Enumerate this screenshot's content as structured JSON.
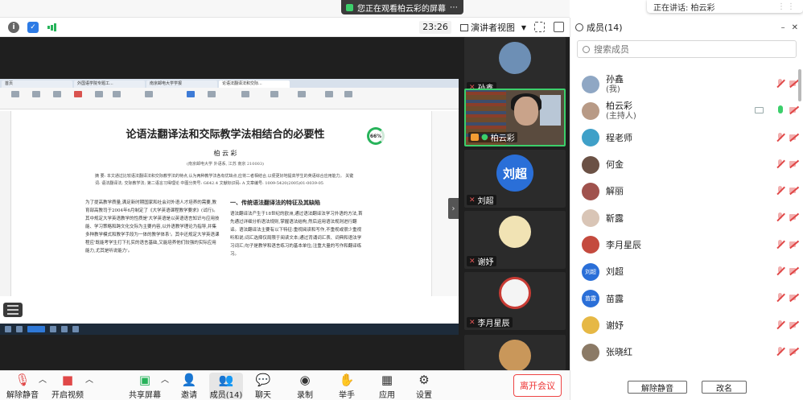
{
  "banner": {
    "share_text": "您正在观看柏云彩的屏幕",
    "speaking_text": "正在讲话: 柏云彩"
  },
  "toolbar": {
    "time": "23:26",
    "view_mode": "演讲者视图"
  },
  "shared_content": {
    "tabs": [
      "首页",
      "外国语学院专题工...",
      "南京邮电大学学报",
      "论语法翻译法和交际..."
    ],
    "progress": "66%",
    "paper_title": "论语法翻译法和交际教学法相结合的必要性",
    "paper_author": "柏 云 彩",
    "paper_affiliation": "(南京邮电大学 外语系, 江苏 南京 210003)",
    "abstract": "摘 要: 本文通过比较语法翻译法和交际教学法的特点,认为两种教学法各有优缺点,应将二者相结合,以便更好地提高学生的英语综合应用能力。 关键词: 语法翻译法; 交际教学法; 第二语言习得理论 中图分类号: G642.4 文献标识码: A 文章编号: 1009-5420(2005)01-0039-05",
    "col1": "为了提高教学质量,满足新时期国家和社会对外语人才培养的需要,教育部高教司于2004年6月制定了《大学英语课程教学要求》(试行)。其中规定大学英语教学的性质是'大学英语是以英语语言知识与应用技能、学习策略和跨文化交际为主要内容,以外语教学理论为指导,并集多种教学模式和教学手段为一体的教学体系'。其中还规定大学英语课程应'既能考学生打下扎实的语言基础,又能培养他们较强的实际应用能力,尤其是听说能力'。",
    "section_heading": "一、传统语法翻译法的特征及其缺陷",
    "col2": "语法翻译法产生于18世纪的欧洲,通过语法翻译法学习外语的方法,首先通过详细分析语法规则,掌握语法结构,然后运用语法规则进行翻译。语法翻译法主要有以下特征:重视阅读和写作,不重视或很少重视听和说;词汇选择仅局限于阅读文本;通过背诵词汇表、词典和语法学习词汇;句子是教学和语言练习的基本单位;注重大量的写作和翻译练习。"
  },
  "video_tiles": [
    {
      "name": "孙鑫"
    },
    {
      "name": "柏云彩"
    },
    {
      "name": "刘超",
      "initials": "刘超"
    },
    {
      "name": "谢妤"
    },
    {
      "name": "李月星辰"
    }
  ],
  "controls": {
    "unmute": "解除静音",
    "start_video": "开启视频",
    "share_screen": "共享屏幕",
    "invite": "邀请",
    "participants": "成员(14)",
    "chat": "聊天",
    "record": "录制",
    "raise_hand": "举手",
    "apps": "应用",
    "settings": "设置",
    "leave": "离开会议"
  },
  "panel": {
    "title": "成员(14)",
    "search_placeholder": "搜索成员",
    "unmute_all": "解除静音",
    "rename": "改名",
    "members": [
      {
        "name": "孙鑫",
        "sub": "(我)",
        "color": "#8fa7c4"
      },
      {
        "name": "柏云彩",
        "sub": "(主持人)",
        "color": "#b89a86"
      },
      {
        "name": "程老师",
        "color": "#3fa0c8"
      },
      {
        "name": "何金",
        "color": "#6b5145"
      },
      {
        "name": "解丽",
        "color": "#a0524d"
      },
      {
        "name": "靳露",
        "color": "#d9c5b6"
      },
      {
        "name": "李月星辰",
        "color": "#c44a3e"
      },
      {
        "name": "刘超",
        "initials": "刘超",
        "color": "#2a6fd8"
      },
      {
        "name": "苗露",
        "initials": "苗露",
        "color": "#2a6fd8"
      },
      {
        "name": "谢妤",
        "color": "#e6b845"
      },
      {
        "name": "张晓红",
        "color": "#8b7a66"
      }
    ]
  }
}
